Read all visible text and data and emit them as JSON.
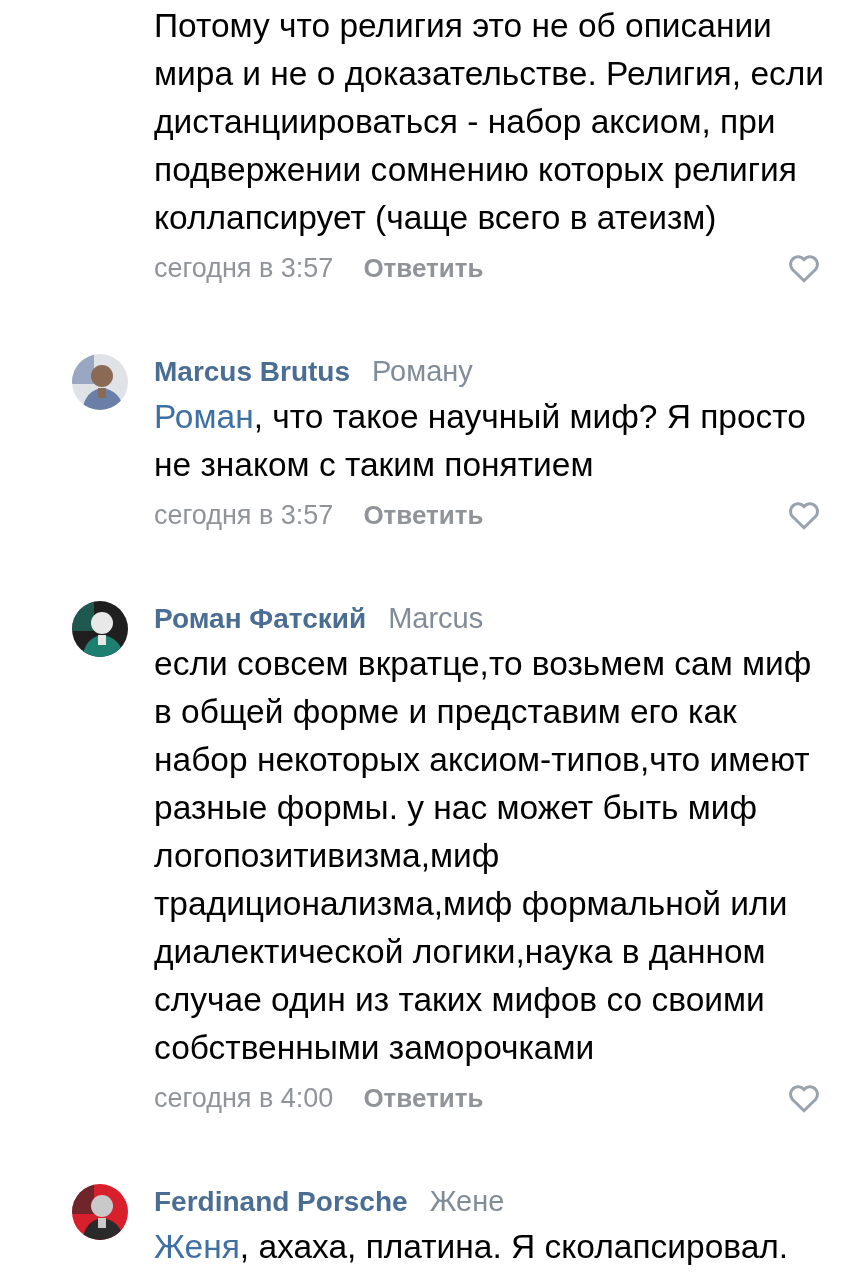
{
  "comments": [
    {
      "text": "Потому что религия это не об описании мира и не о доказательстве. Религия, если дистанциироваться - набор аксиом, при подвержении сомнению которых религия коллапсирует (чаще всего в атеизм)",
      "time": "сегодня в 3:57",
      "reply_label": "Ответить",
      "liked": false
    },
    {
      "author": "Marcus Brutus",
      "reply_to": "Роману",
      "mention": "Роман",
      "text": ", что такое научный миф? Я просто не знаком с таким понятием",
      "time": "сегодня в 3:57",
      "reply_label": "Ответить",
      "liked": false
    },
    {
      "author": "Роман Фатский",
      "reply_to": "Marcus",
      "text": "если совсем вкратце,то возьмем сам миф в общей форме и представим его как набор некоторых аксиом-типов,что имеют разные формы. у нас может быть миф логопозитивизма,миф традиционализма,миф формальной или диалектической логики,наука в данном случае один из таких мифов со своими собственными заморочками",
      "time": "сегодня в 4:00",
      "reply_label": "Ответить",
      "liked": false
    },
    {
      "author": "Ferdinand Porsche",
      "reply_to": "Жене",
      "mention": "Женя",
      "text": ", ахаха, платина. Я сколапсировал."
    }
  ]
}
